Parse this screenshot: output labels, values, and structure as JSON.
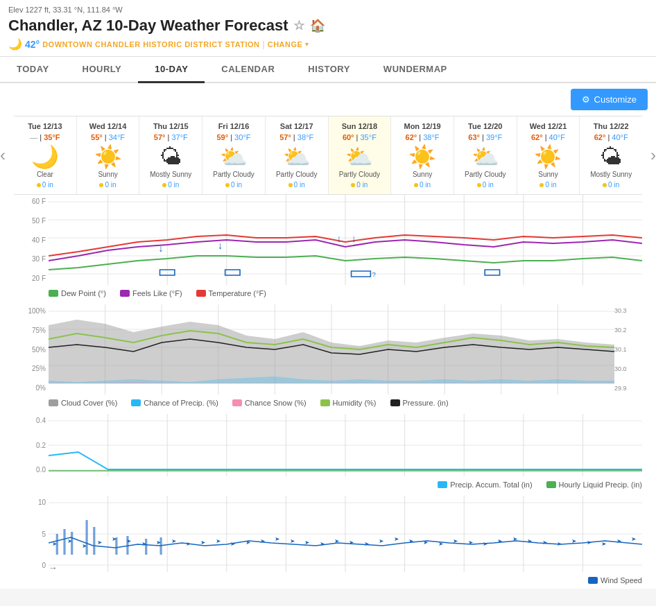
{
  "header": {
    "elev": "Elev 1227 ft, 33.31 °N, 111.84 °W",
    "title": "Chandler, AZ 10-Day Weather Forecast",
    "current_temp": "42°",
    "station": "DOWNTOWN CHANDLER HISTORIC DISTRICT STATION",
    "change_label": "CHANGE"
  },
  "nav": {
    "tabs": [
      "TODAY",
      "HOURLY",
      "10-DAY",
      "CALENDAR",
      "HISTORY",
      "WUNDERMAP"
    ],
    "active": "10-DAY"
  },
  "customize_label": "Customize",
  "forecast": {
    "days": [
      {
        "date": "Tue 12/13",
        "high": "35°F",
        "low": "—",
        "desc": "Clear",
        "icon": "🌙",
        "precip": "0 in"
      },
      {
        "date": "Wed 12/14",
        "high": "55°F",
        "low": "34°F",
        "desc": "Sunny",
        "icon": "☀️",
        "precip": "0 in"
      },
      {
        "date": "Thu 12/15",
        "high": "57°F",
        "low": "37°F",
        "desc": "Mostly Sunny",
        "icon": "🌤",
        "precip": "0 in"
      },
      {
        "date": "Fri 12/16",
        "high": "59°F",
        "low": "30°F",
        "desc": "Partly Cloudy",
        "icon": "⛅",
        "precip": "0 in"
      },
      {
        "date": "Sat 12/17",
        "high": "57°F",
        "low": "38°F",
        "desc": "Partly Cloudy",
        "icon": "⛅",
        "precip": "0 in"
      },
      {
        "date": "Sun 12/18",
        "high": "60°F",
        "low": "35°F",
        "desc": "Partly Cloudy",
        "icon": "⛅",
        "precip": "0 in"
      },
      {
        "date": "Mon 12/19",
        "high": "62°F",
        "low": "38°F",
        "desc": "Sunny",
        "icon": "☀️",
        "precip": "0 in"
      },
      {
        "date": "Tue 12/20",
        "high": "63°F",
        "low": "39°F",
        "desc": "Partly Cloudy",
        "icon": "⛅",
        "precip": "0 in"
      },
      {
        "date": "Wed 12/21",
        "high": "62°F",
        "low": "40°F",
        "desc": "Sunny",
        "icon": "☀️",
        "precip": "0 in"
      },
      {
        "date": "Thu 12/22",
        "high": "62°F",
        "low": "40°F",
        "desc": "Mostly Sunny",
        "icon": "🌤",
        "precip": "0 in"
      }
    ]
  },
  "charts": {
    "temp": {
      "y_labels": [
        "60 F",
        "50 F",
        "40 F",
        "30 F",
        "20 F"
      ],
      "legend": [
        {
          "label": "Dew Point (°)",
          "color": "#4caf50"
        },
        {
          "label": "Feels Like (°F)",
          "color": "#9c27b0"
        },
        {
          "label": "Temperature (°F)",
          "color": "#e53935"
        }
      ]
    },
    "cloud": {
      "y_labels": [
        "100%",
        "75%",
        "50%",
        "25%",
        "0%"
      ],
      "y_labels_right": [
        "30.3",
        "30.2",
        "30.1",
        "30.0",
        "29.9"
      ],
      "legend": [
        {
          "label": "Cloud Cover (%)",
          "color": "#9e9e9e"
        },
        {
          "label": "Chance of Precip. (%)",
          "color": "#29b6f6"
        },
        {
          "label": "Chance of Snow (%)",
          "color": "#f48fb1"
        },
        {
          "label": "Humidity (%)",
          "color": "#8bc34a"
        },
        {
          "label": "Pressure. (in)",
          "color": "#212121"
        }
      ]
    },
    "precip": {
      "y_labels": [
        "0.4",
        "0.2",
        "0.0"
      ],
      "legend": [
        {
          "label": "Precip. Accum. Total (in)",
          "color": "#29b6f6"
        },
        {
          "label": "Hourly Liquid Precip. (in)",
          "color": "#4caf50"
        }
      ]
    },
    "wind": {
      "y_labels": [
        "10",
        "5",
        "0"
      ],
      "legend": [
        {
          "label": "Wind Speed",
          "color": "#1565c0"
        }
      ]
    }
  }
}
